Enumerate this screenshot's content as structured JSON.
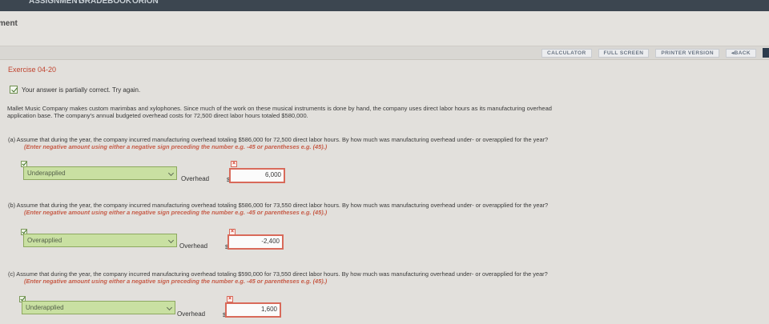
{
  "top_tabs": [
    "Assignment",
    "Gradebook",
    "ORION"
  ],
  "header": {
    "title": "ment"
  },
  "toolbar": {
    "calculator": "CALCULATOR",
    "full_screen": "FULL SCREEN",
    "printer_version": "PRINTER VERSION",
    "back": "BACK"
  },
  "exercise": {
    "title": "Exercise 04-20",
    "status": "Your answer is partially correct.  Try again.",
    "intro_line1": "Mallet Music Company makes custom marimbas and xylophones. Since much of the work on these musical instruments is done by hand, the company uses direct labor hours as its manufacturing overhead",
    "intro_line2": "application base. The company's annual budgeted overhead costs for 72,500 direct labor hours totaled $580,000."
  },
  "questions": [
    {
      "text": "(a) Assume that during the year, the company incurred manufacturing overhead totaling $586,000 for 72,500 direct labor hours. By how much was manufacturing overhead under- or overapplied for the year?",
      "hint": "(Enter negative amount using either a negative sign preceding the number e.g. -45 or parentheses e.g. (45).)",
      "selection": "Underapplied",
      "label": "Overhead",
      "currency": "$",
      "value": "6,000"
    },
    {
      "text": "(b) Assume that during the year, the company incurred manufacturing overhead totaling $586,000 for 73,550 direct labor hours. By how much was manufacturing overhead under- or overapplied for the year?",
      "hint": "(Enter negative amount using either a negative sign preceding the number e.g. -45 or parentheses e.g. (45).)",
      "selection": "Overapplied",
      "label": "Overhead",
      "currency": "$",
      "value": "-2,400"
    },
    {
      "text": "(c) Assume that during the year, the company incurred manufacturing overhead totaling $590,000 for 73,550 direct labor hours. By how much was manufacturing overhead under- or overapplied for the year?",
      "hint": "(Enter negative amount using either a negative sign preceding the number e.g. -45 or parentheses e.g. (45).)",
      "selection": "Underapplied",
      "label": "Overhead",
      "currency": "$",
      "value": "1,600"
    }
  ]
}
